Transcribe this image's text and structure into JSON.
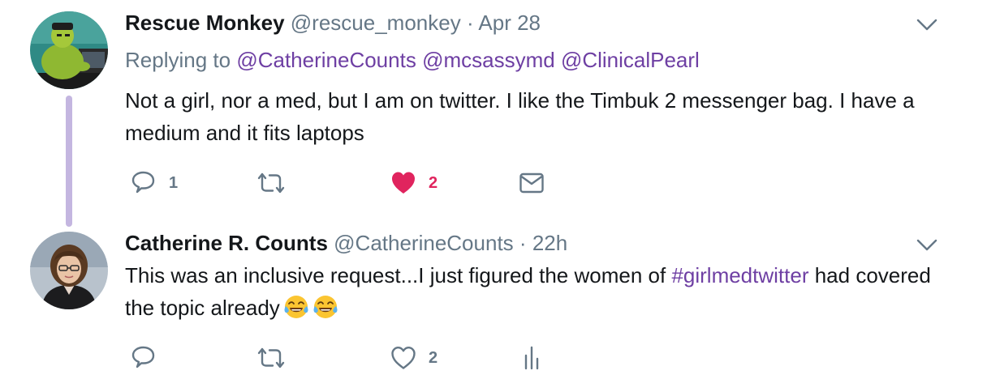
{
  "tweets": [
    {
      "author_name": "Rescue Monkey",
      "handle": "@rescue_monkey",
      "separator": "·",
      "time": "Apr 28",
      "replying_prefix": "Replying to",
      "replying_to": [
        "@CatherineCounts",
        "@mcsassymd",
        "@ClinicalPearl"
      ],
      "text": "Not a girl, nor a med, but I am on twitter. I like the Timbuk 2 messenger bag. I have a medium and it fits laptops",
      "reply_count": "1",
      "like_count": "2",
      "liked": true,
      "icons": [
        "avatar",
        "chevron-down-icon",
        "reply-icon",
        "retweet-icon",
        "heart-filled-icon",
        "envelope-icon"
      ]
    },
    {
      "author_name": "Catherine R. Counts",
      "handle": "@CatherineCounts",
      "separator": "·",
      "time": "22h",
      "text_before": "This was an inclusive request...I just figured the women of ",
      "hashtag": "#girlmedtwitter",
      "text_after": " had covered the topic already",
      "emoji": [
        "face-with-tears-of-joy",
        "face-with-tears-of-joy"
      ],
      "like_count": "2",
      "liked": false,
      "icons": [
        "avatar",
        "chevron-down-icon",
        "reply-icon",
        "retweet-icon",
        "heart-outline-icon",
        "analytics-icon"
      ]
    }
  ],
  "colors": {
    "text": "#14171a",
    "secondary": "#657786",
    "link": "#6e3fa3",
    "like": "#e0245e",
    "thread_line": "#c4b6e0"
  }
}
